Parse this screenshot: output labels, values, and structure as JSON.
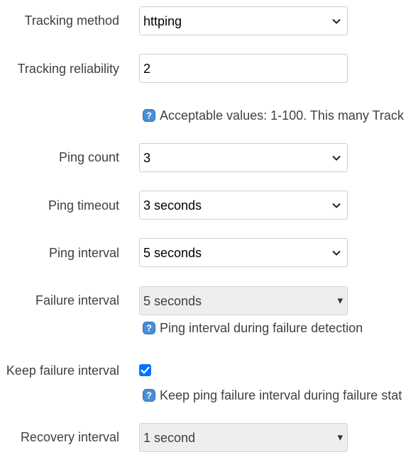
{
  "tracking_method": {
    "label": "Tracking method",
    "value": "httping"
  },
  "tracking_reliability": {
    "label": "Tracking reliability",
    "value": "2",
    "help": "Acceptable values: 1-100. This many Track"
  },
  "ping_count": {
    "label": "Ping count",
    "value": "3"
  },
  "ping_timeout": {
    "label": "Ping timeout",
    "value": "3 seconds"
  },
  "ping_interval": {
    "label": "Ping interval",
    "value": "5 seconds"
  },
  "failure_interval": {
    "label": "Failure interval",
    "value": "5 seconds",
    "help": "Ping interval during failure detection"
  },
  "keep_failure_interval": {
    "label": "Keep failure interval",
    "checked": true,
    "help": "Keep ping failure interval during failure stat"
  },
  "recovery_interval": {
    "label": "Recovery interval",
    "value": "1 second"
  },
  "icons": {
    "help": "help-question-icon",
    "select": "chevron-down-icon",
    "disabled_select": "caret-down-icon",
    "check": "checkmark-icon"
  },
  "colors": {
    "checkbox": "#0075ff",
    "help_icon": "#4a8fd6"
  }
}
